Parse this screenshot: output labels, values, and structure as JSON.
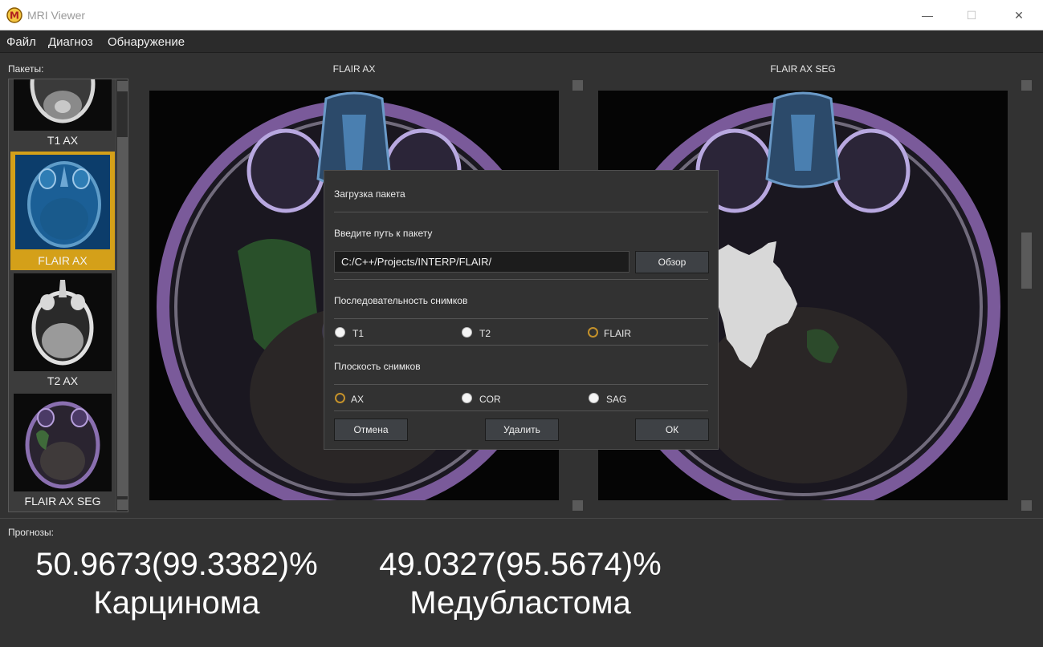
{
  "window": {
    "title": "MRI Viewer",
    "minimize": "—",
    "maximize": "☐",
    "close": "✕"
  },
  "menu": [
    "Файл",
    "Диагноз",
    "Обнаружение"
  ],
  "packages": {
    "label": "Пакеты:",
    "items": [
      {
        "label": "T1 AX",
        "selected": false
      },
      {
        "label": "FLAIR AX",
        "selected": true
      },
      {
        "label": "T2 AX",
        "selected": false
      },
      {
        "label": "FLAIR AX SEG",
        "selected": false
      }
    ]
  },
  "viewers": [
    {
      "title": "FLAIR AX"
    },
    {
      "title": "FLAIR AX SEG"
    }
  ],
  "dialog": {
    "title": "Загрузка пакета",
    "path_label": "Введите путь к пакету",
    "path_value": "C:/C++/Projects/INTERP/FLAIR/",
    "browse": "Обзор",
    "sequence_label": "Последовательность снимков",
    "sequence_options": [
      {
        "label": "T1",
        "checked": false
      },
      {
        "label": "T2",
        "checked": false
      },
      {
        "label": "FLAIR",
        "checked": true
      }
    ],
    "plane_label": "Плоскость снимков",
    "plane_options": [
      {
        "label": "AX",
        "checked": true
      },
      {
        "label": "COR",
        "checked": false
      },
      {
        "label": "SAG",
        "checked": false
      }
    ],
    "cancel": "Отмена",
    "delete": "Удалить",
    "ok": "ОК"
  },
  "prognoses": {
    "label": "Прогнозы:",
    "items": [
      {
        "value": "50.9673(99.3382)%",
        "name": "Карцинома"
      },
      {
        "value": "49.0327(95.5674)%",
        "name": "Медубластома"
      }
    ]
  },
  "colors": {
    "accent": "#d4a019",
    "background": "#323232",
    "radio_checked": "#c4912a"
  }
}
